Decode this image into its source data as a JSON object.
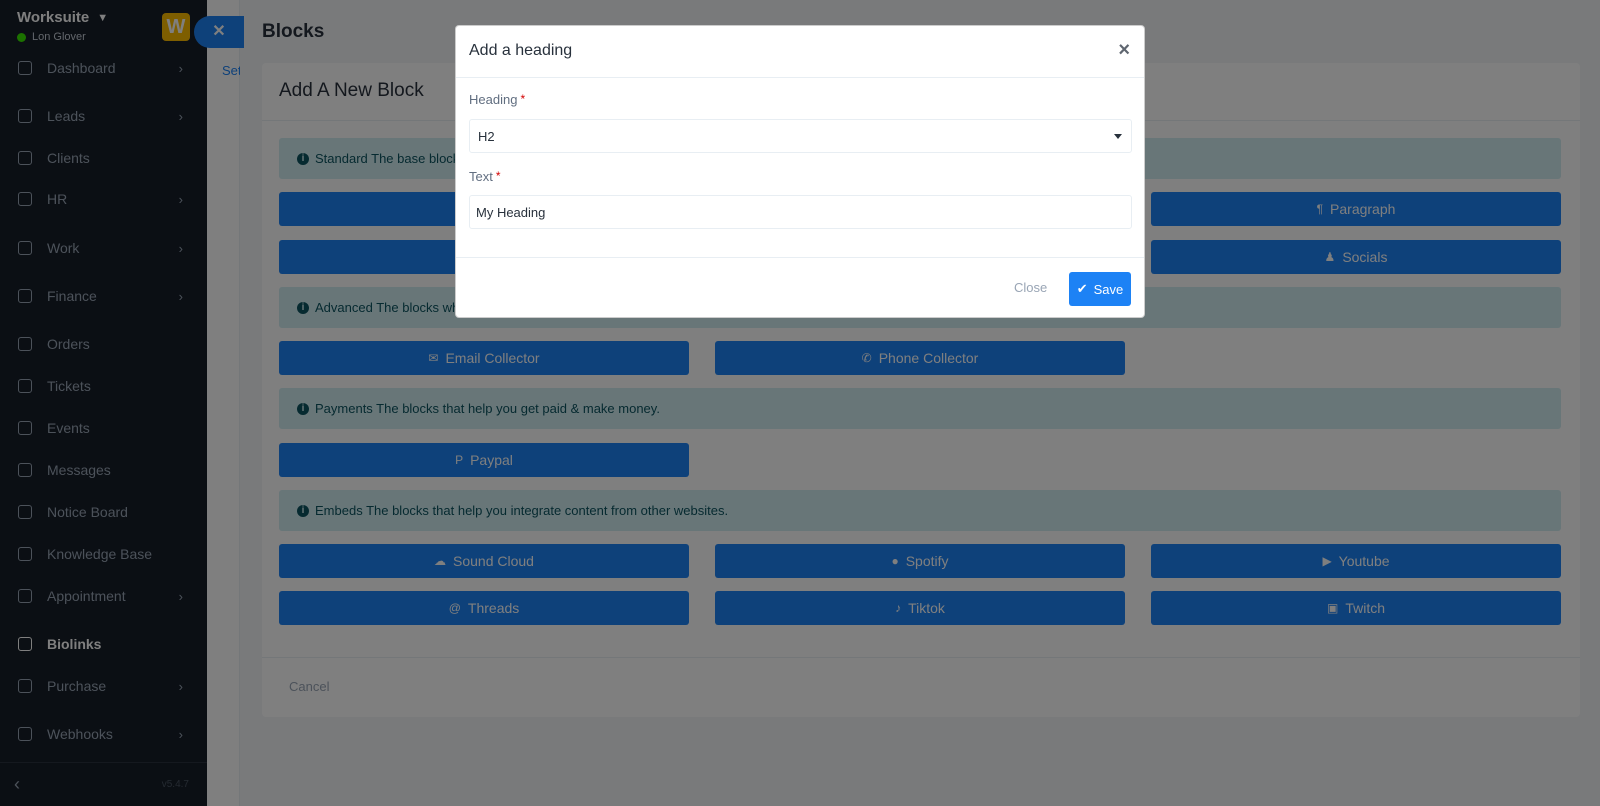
{
  "sidebar": {
    "brand": "Worksuite",
    "user": "Lon Glover",
    "logo_letter": "W",
    "items": [
      {
        "label": "Dashboard",
        "chevron": true,
        "icon": "house-icon"
      },
      {
        "label": "Leads",
        "chevron": true,
        "icon": "people-icon"
      },
      {
        "label": "Clients",
        "chevron": false,
        "icon": "chart-icon"
      },
      {
        "label": "HR",
        "chevron": true,
        "icon": "people-icon"
      },
      {
        "label": "Work",
        "chevron": true,
        "icon": "briefcase-icon"
      },
      {
        "label": "Finance",
        "chevron": true,
        "icon": "dollar-icon"
      },
      {
        "label": "Orders",
        "chevron": false,
        "icon": "cart-icon"
      },
      {
        "label": "Tickets",
        "chevron": false,
        "icon": "headset-icon"
      },
      {
        "label": "Events",
        "chevron": false,
        "icon": "calendar-icon"
      },
      {
        "label": "Messages",
        "chevron": false,
        "icon": "message-icon"
      },
      {
        "label": "Notice Board",
        "chevron": false,
        "icon": "clipboard-icon"
      },
      {
        "label": "Knowledge Base",
        "chevron": false,
        "icon": "book-icon"
      },
      {
        "label": "Appointment",
        "chevron": true,
        "icon": "appointment-icon"
      },
      {
        "label": "Biolinks",
        "chevron": false,
        "icon": "biolink-icon",
        "active": true
      },
      {
        "label": "Purchase",
        "chevron": true,
        "icon": "purchase-icon"
      },
      {
        "label": "Webhooks",
        "chevron": true,
        "icon": "webhook-icon"
      }
    ],
    "version": "v5.4.7"
  },
  "panel": {
    "settings_link": "Set",
    "title": "Blocks",
    "card_title": "Add A New Block",
    "sections": {
      "standard": "Standard The base blocks",
      "advanced": "Advanced The blocks whi",
      "payments": "Payments The blocks that help you get paid & make money.",
      "embeds": "Embeds The blocks that help you integrate content from other websites."
    },
    "blocks": {
      "paragraph": "Paragraph",
      "socials": "Socials",
      "email_collector": "Email Collector",
      "phone_collector": "Phone Collector",
      "paypal": "Paypal",
      "sound_cloud": "Sound Cloud",
      "spotify": "Spotify",
      "youtube": "Youtube",
      "threads": "Threads",
      "tiktok": "Tiktok",
      "twitch": "Twitch"
    },
    "cancel": "Cancel"
  },
  "modal": {
    "title": "Add a heading",
    "close_symbol": "×",
    "heading_label": "Heading",
    "heading_value": "H2",
    "text_label": "Text",
    "text_value": "My Heading",
    "close_label": "Close",
    "save_label": "Save",
    "required_mark": "*"
  },
  "colors": {
    "primary": "#1d82f5",
    "sidebar_bg": "#171f29",
    "info_bg": "#d1ecf1"
  }
}
